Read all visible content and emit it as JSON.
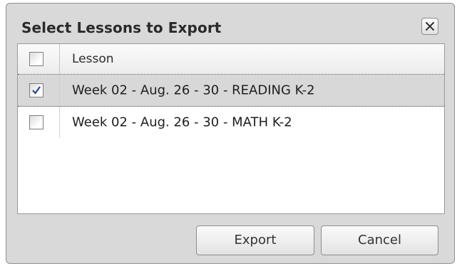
{
  "dialog": {
    "title": "Select Lessons to Export",
    "close_icon": "close-x-icon"
  },
  "grid": {
    "header": {
      "select_all_checked": false,
      "column_label": "Lesson"
    },
    "rows": [
      {
        "label": "Week 02 - Aug. 26 - 30 - READING K-2",
        "checked": true,
        "selected": true
      },
      {
        "label": "Week 02 - Aug. 26 - 30 - MATH K-2",
        "checked": false,
        "selected": false
      }
    ]
  },
  "buttons": {
    "export_label": "Export",
    "cancel_label": "Cancel"
  },
  "colors": {
    "check_mark": "#2a4a8a",
    "selected_row": "#d8d8d8",
    "dialog_bg": "#d9d9d9"
  }
}
